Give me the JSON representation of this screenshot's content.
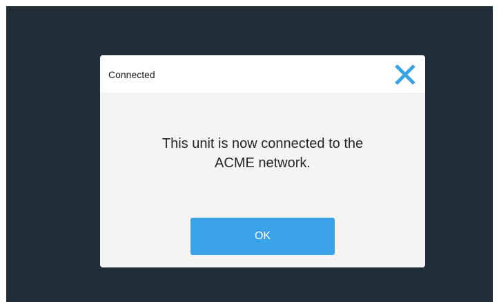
{
  "dialog": {
    "title": "Connected",
    "message_line1": "This unit is now connected to the",
    "message_line2": "ACME network.",
    "ok_label": "OK",
    "close_icon": "close-icon"
  },
  "colors": {
    "background": "#212d36",
    "dialog_body": "#f4f4f4",
    "header": "#ffffff",
    "accent": "#3aa3e8"
  }
}
